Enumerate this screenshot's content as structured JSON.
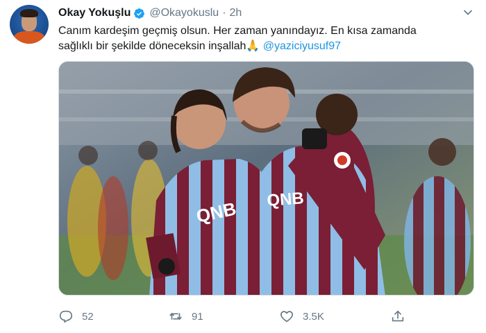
{
  "author": {
    "name": "Okay Yokuşlu",
    "handle": "@Okayokuslu",
    "separator": "·",
    "time": "2h",
    "verified": true,
    "avatar_icon": "profile-avatar"
  },
  "tweet": {
    "line1": "Canım kardeşim geçmiş olsun. Her zaman yanındayız. En kısa zamanda",
    "line2_text": "sağlıklı bir şekilde döneceksin inşallah",
    "line2_emoji": "🙏",
    "mention": "@yaziciyusuf97"
  },
  "media": {
    "jersey_sponsor": "QNB",
    "colors": {
      "claret": "#7a1f35",
      "sky_blue": "#7fb2df",
      "pitch_green": "#5f8a4a"
    }
  },
  "actions": {
    "reply_count": "52",
    "retweet_count": "91",
    "like_count": "3.5K",
    "reply_icon": "reply-icon",
    "retweet_icon": "retweet-icon",
    "like_icon": "heart-icon",
    "share_icon": "share-icon"
  },
  "colors": {
    "link": "#1b95e0",
    "secondary_text": "#657786",
    "verified": "#1da1f2"
  }
}
